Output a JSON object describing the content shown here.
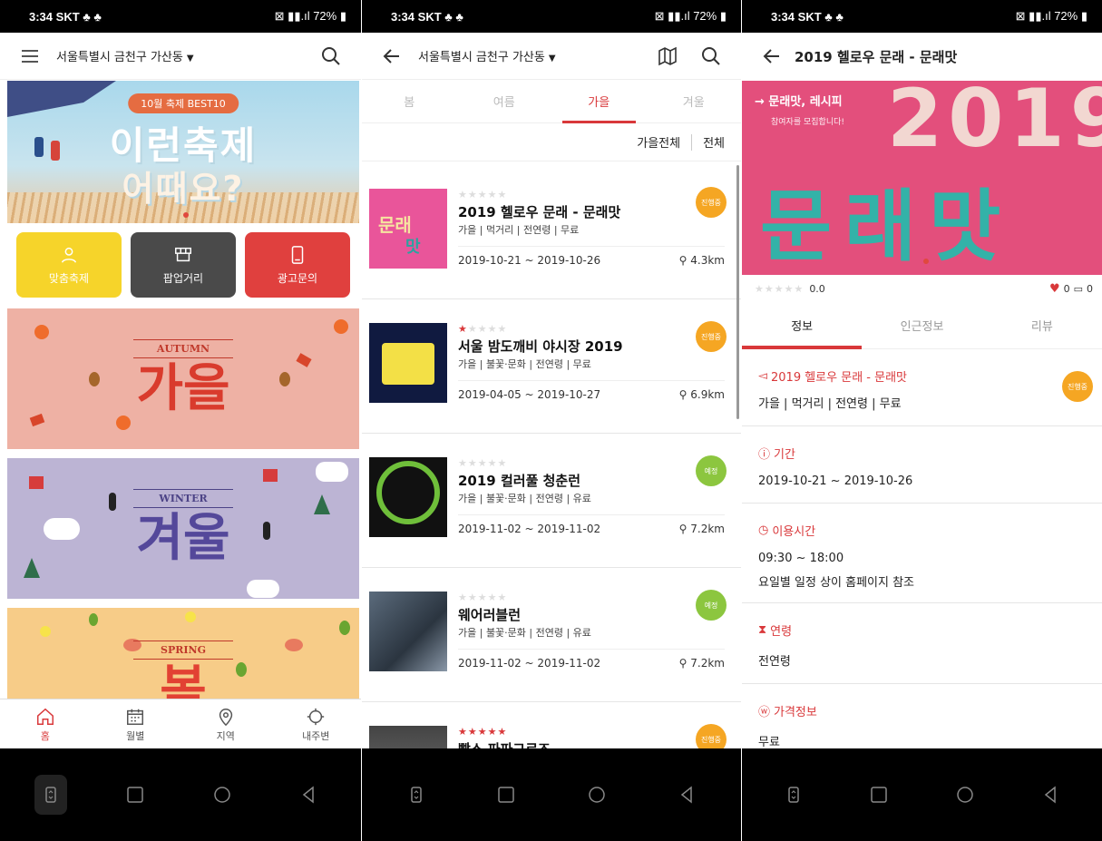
{
  "status": {
    "time": "3:34",
    "carrier": "SKT",
    "battery": "72%"
  },
  "p1": {
    "location": "서울특별시 금천구 가산동",
    "banner": {
      "tag": "10월 축제 BEST10",
      "line1": "이런축제",
      "line2": "어때요?"
    },
    "categories": [
      {
        "label": "맞춤축제",
        "icon": "person-icon"
      },
      {
        "label": "팝업거리",
        "icon": "stall-icon"
      },
      {
        "label": "광고문의",
        "icon": "tablet-icon"
      }
    ],
    "seasons": [
      {
        "eng": "AUTUMN",
        "kor": "가을"
      },
      {
        "eng": "WINTER",
        "kor": "겨울"
      },
      {
        "eng": "SPRING",
        "kor": "봄"
      }
    ],
    "tabs": [
      {
        "label": "홈",
        "icon": "home-icon"
      },
      {
        "label": "월별",
        "icon": "calendar-icon"
      },
      {
        "label": "지역",
        "icon": "location-icon"
      },
      {
        "label": "내주변",
        "icon": "compass-icon"
      }
    ]
  },
  "p2": {
    "location": "서울특별시 금천구 가산동",
    "season_tabs": [
      "봄",
      "여름",
      "가을",
      "겨울"
    ],
    "filter_season": "가을전체",
    "filter_all": "전체",
    "items": [
      {
        "title": "2019 헬로우 문래 - 문래맛",
        "sub": "가을 | 먹거리 | 전연령 | 무료",
        "date": "2019-10-21 ~ 2019-10-26",
        "dist": "4.3km",
        "badge": "진행중",
        "stars": 0
      },
      {
        "title": "서울 밤도깨비 야시장 2019",
        "sub": "가을 | 불꽃·문화 | 전연령 | 무료",
        "date": "2019-04-05 ~ 2019-10-27",
        "dist": "6.9km",
        "badge": "진행중",
        "stars": 1
      },
      {
        "title": "2019 컬러풀 청춘런",
        "sub": "가을 | 불꽃·문화 | 전연령 | 유료",
        "date": "2019-11-02 ~ 2019-11-02",
        "dist": "7.2km",
        "badge": "예정",
        "stars": 0
      },
      {
        "title": "웨어러블런",
        "sub": "가을 | 불꽃·문화 | 전연령 | 유료",
        "date": "2019-11-02 ~ 2019-11-02",
        "dist": "7.2km",
        "badge": "예정",
        "stars": 0
      },
      {
        "title": "빡스 파파그로즈",
        "sub": "",
        "date": "",
        "dist": "",
        "badge": "진행중",
        "stars": 5
      }
    ]
  },
  "p3": {
    "title": "2019 헬로우 문래 - 문래맛",
    "hero": {
      "line1": "→ 문래맛, 레시피",
      "line2": "참여자를 모집합니다!",
      "year": "2019",
      "name": "문래맛"
    },
    "score": "0.0",
    "likes": "0",
    "comments": "0",
    "tabs": [
      "정보",
      "인근정보",
      "리뷰"
    ],
    "event_name": "2019 헬로우 문래 - 문래맛",
    "event_sub": "가을 | 먹거리 | 전연령 | 무료",
    "badge": "진행중",
    "period_label": "기간",
    "period": "2019-10-21 ~ 2019-10-26",
    "hours_label": "이용시간",
    "hours": "09:30 ~ 18:00",
    "hours_note": "요일별 일정 상이 홈페이지 참조",
    "age_label": "연령",
    "age": "전연령",
    "price_label": "가격정보",
    "price": "무료"
  },
  "colors": {
    "accent": "#d9383a",
    "yellow": "#f6d42a",
    "orange": "#f5a623",
    "green": "#8cc63f"
  }
}
